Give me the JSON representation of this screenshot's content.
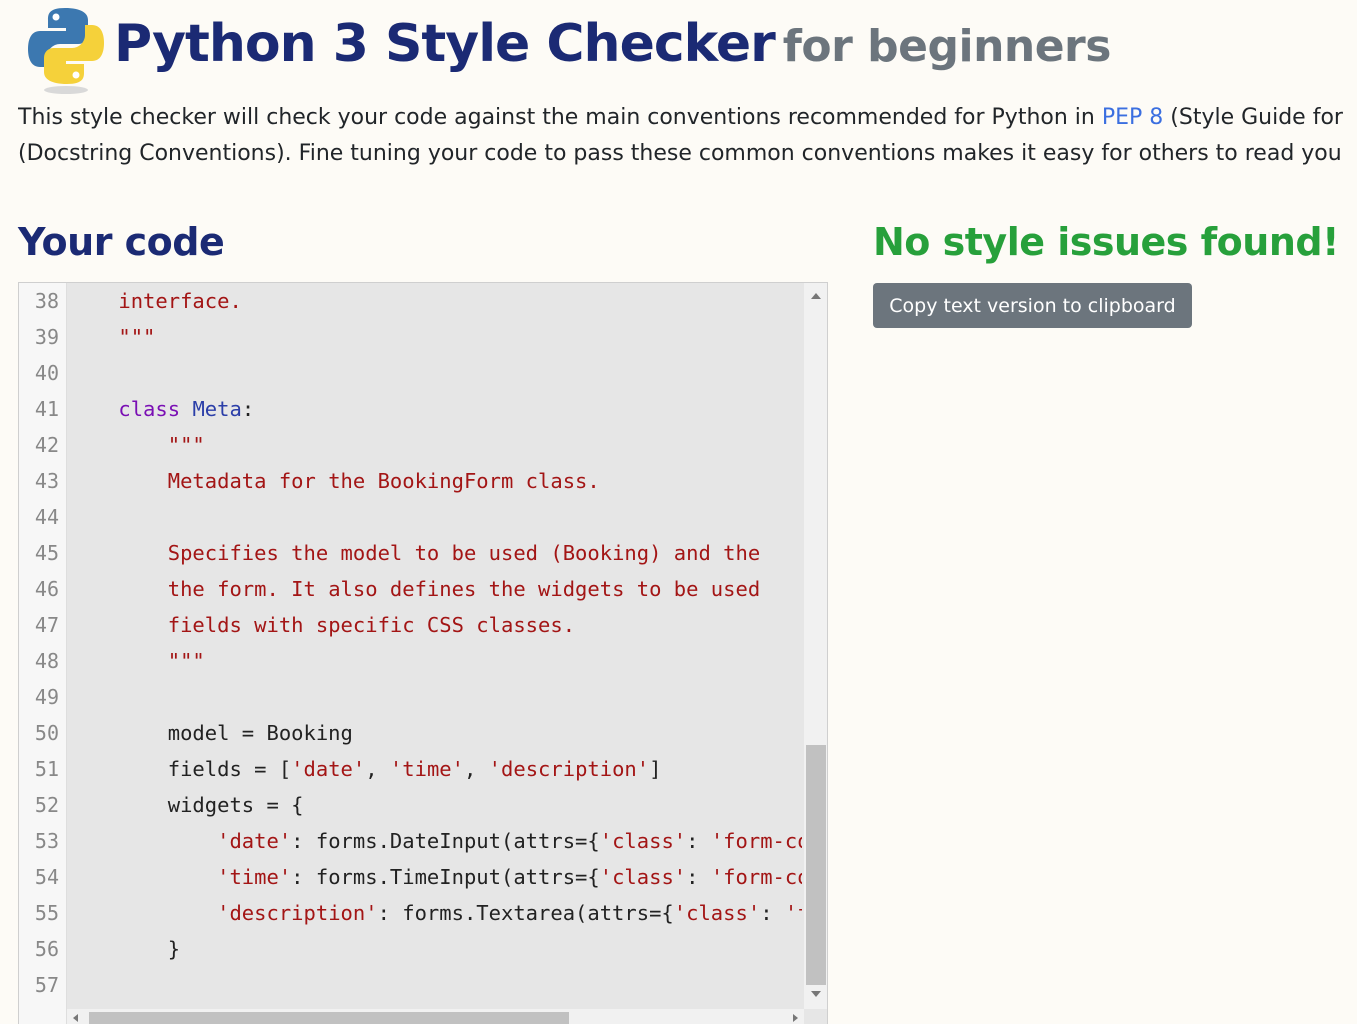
{
  "header": {
    "title": "Python 3 Style Checker",
    "subtitle": "for beginners"
  },
  "intro": {
    "line1_pre": "This style checker will check your code against the main conventions recommended for Python in ",
    "pep8_link": "PEP 8",
    "line1_post": " (Style Guide for",
    "line2": "(Docstring Conventions). Fine tuning your code to pass these common conventions makes it easy for others to read you"
  },
  "your_code": {
    "heading": "Your code"
  },
  "results": {
    "heading": "No style issues found!",
    "copy_button": "Copy text version to clipboard"
  },
  "editor": {
    "line_numbers": [
      "38",
      "39",
      "40",
      "41",
      "42",
      "43",
      "44",
      "45",
      "46",
      "47",
      "48",
      "49",
      "50",
      "51",
      "52",
      "53",
      "54",
      "55",
      "56",
      "57"
    ],
    "lines": [
      [
        [
          "    ",
          ""
        ],
        [
          "interface.",
          "s"
        ]
      ],
      [
        [
          "    ",
          ""
        ],
        [
          "\"\"\"",
          "s"
        ]
      ],
      [],
      [
        [
          "    ",
          ""
        ],
        [
          "class",
          "k"
        ],
        [
          " ",
          ""
        ],
        [
          "Meta",
          "d"
        ],
        [
          ":",
          ""
        ]
      ],
      [
        [
          "        ",
          ""
        ],
        [
          "\"\"\"",
          "s"
        ]
      ],
      [
        [
          "        ",
          ""
        ],
        [
          "Metadata for the BookingForm class.",
          "s"
        ]
      ],
      [],
      [
        [
          "        ",
          ""
        ],
        [
          "Specifies the model to be used (Booking) and the",
          "s"
        ]
      ],
      [
        [
          "        ",
          ""
        ],
        [
          "the form. It also defines the widgets to be used",
          "s"
        ]
      ],
      [
        [
          "        ",
          ""
        ],
        [
          "fields with specific CSS classes.",
          "s"
        ]
      ],
      [
        [
          "        ",
          ""
        ],
        [
          "\"\"\"",
          "s"
        ]
      ],
      [],
      [
        [
          "        model = Booking",
          ""
        ]
      ],
      [
        [
          "        fields = [",
          ""
        ],
        [
          "'date'",
          "s"
        ],
        [
          ", ",
          ""
        ],
        [
          "'time'",
          "s"
        ],
        [
          ", ",
          ""
        ],
        [
          "'description'",
          "s"
        ],
        [
          "]",
          ""
        ]
      ],
      [
        [
          "        widgets = {",
          ""
        ]
      ],
      [
        [
          "            ",
          ""
        ],
        [
          "'date'",
          "s"
        ],
        [
          ": forms.DateInput(attrs={",
          ""
        ],
        [
          "'class'",
          "s"
        ],
        [
          ": ",
          ""
        ],
        [
          "'form-control'",
          "s"
        ]
      ],
      [
        [
          "            ",
          ""
        ],
        [
          "'time'",
          "s"
        ],
        [
          ": forms.TimeInput(attrs={",
          ""
        ],
        [
          "'class'",
          "s"
        ],
        [
          ": ",
          ""
        ],
        [
          "'form-control'",
          "s"
        ]
      ],
      [
        [
          "            ",
          ""
        ],
        [
          "'description'",
          "s"
        ],
        [
          ": forms.Textarea(attrs={",
          ""
        ],
        [
          "'class'",
          "s"
        ],
        [
          ": ",
          ""
        ],
        [
          "'form-control'",
          "s"
        ]
      ],
      [
        [
          "        }",
          ""
        ]
      ],
      []
    ]
  },
  "colors": {
    "title": "#1b2a74",
    "subtitle": "#6c757d",
    "success": "#27a03b",
    "link": "#3b6fe0",
    "button": "#6c757d",
    "string": "#a31515",
    "keyword": "#7a0fb4",
    "definition": "#2b3ea8"
  },
  "icons": {
    "logo": "python-logo-icon"
  }
}
